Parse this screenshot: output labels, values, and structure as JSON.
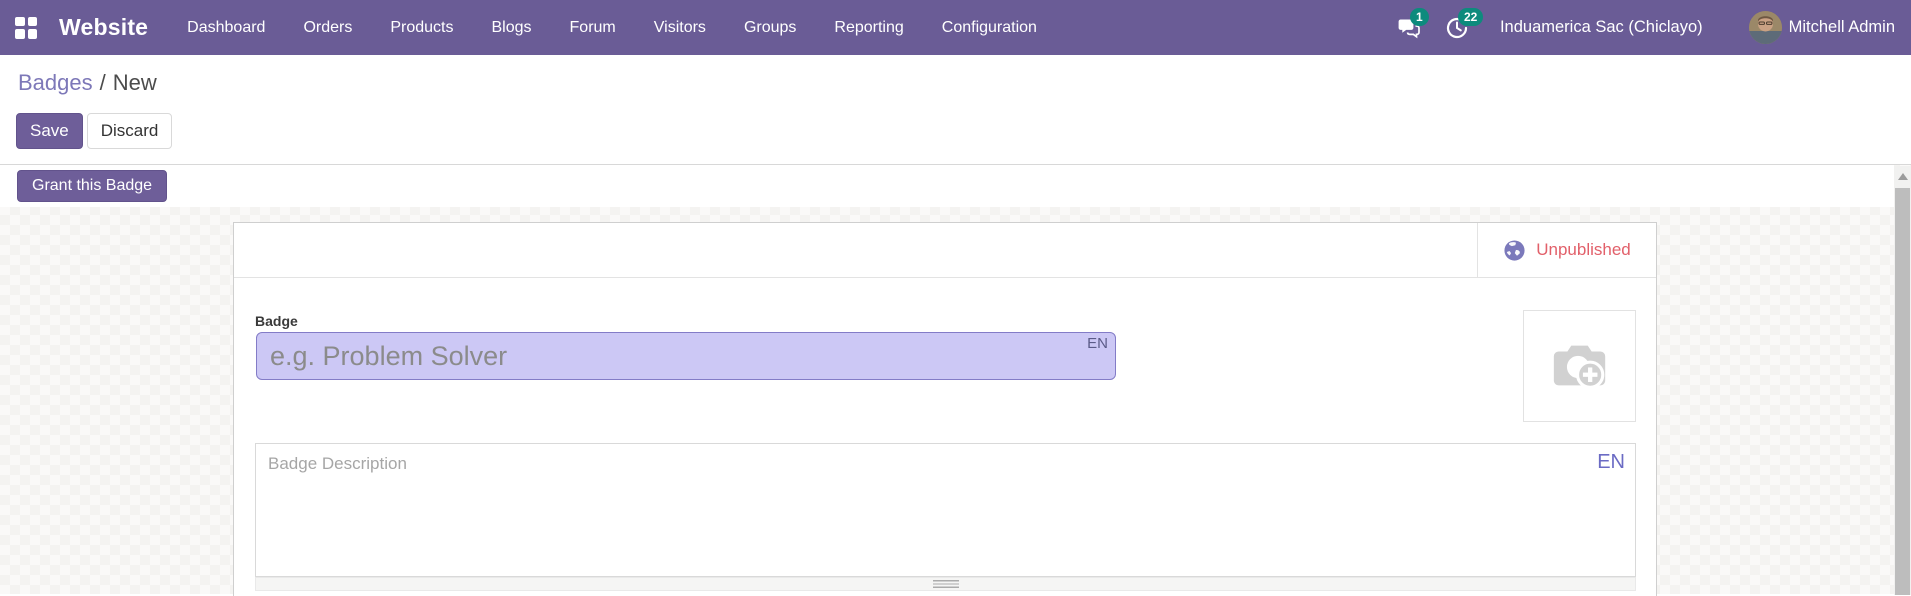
{
  "navbar": {
    "brand": "Website",
    "menu": [
      "Dashboard",
      "Orders",
      "Products",
      "Blogs",
      "Forum",
      "Visitors",
      "Groups",
      "Reporting",
      "Configuration"
    ],
    "messages_count": "1",
    "activities_count": "22",
    "company": "Induamerica Sac (Chiclayo)",
    "user": "Mitchell Admin"
  },
  "breadcrumb": {
    "parent": "Badges",
    "separator": "/",
    "current": "New"
  },
  "toolbar": {
    "save_label": "Save",
    "discard_label": "Discard"
  },
  "actions": {
    "grant_label": "Grant this Badge"
  },
  "sheet": {
    "status": {
      "label": "Unpublished"
    },
    "badge_field": {
      "label": "Badge",
      "value": "",
      "placeholder": "e.g. Problem Solver",
      "lang": "EN"
    },
    "description_field": {
      "value": "",
      "placeholder": "Badge Description",
      "lang": "EN"
    }
  },
  "icons": {
    "apps": "apps-grid-icon",
    "messages": "chat-bubbles-icon",
    "activity": "clock-icon",
    "status": "globe-icon",
    "image_upload": "camera-plus-icon"
  },
  "colors": {
    "navbar_bg": "#6a5c96",
    "primary_button": "#6e5e99",
    "count_badge": "#0d8b7d",
    "status_unpublished": "#e2606a",
    "translatable_field_bg": "#ccc8f5",
    "breadcrumb_link": "#7d78b8"
  }
}
